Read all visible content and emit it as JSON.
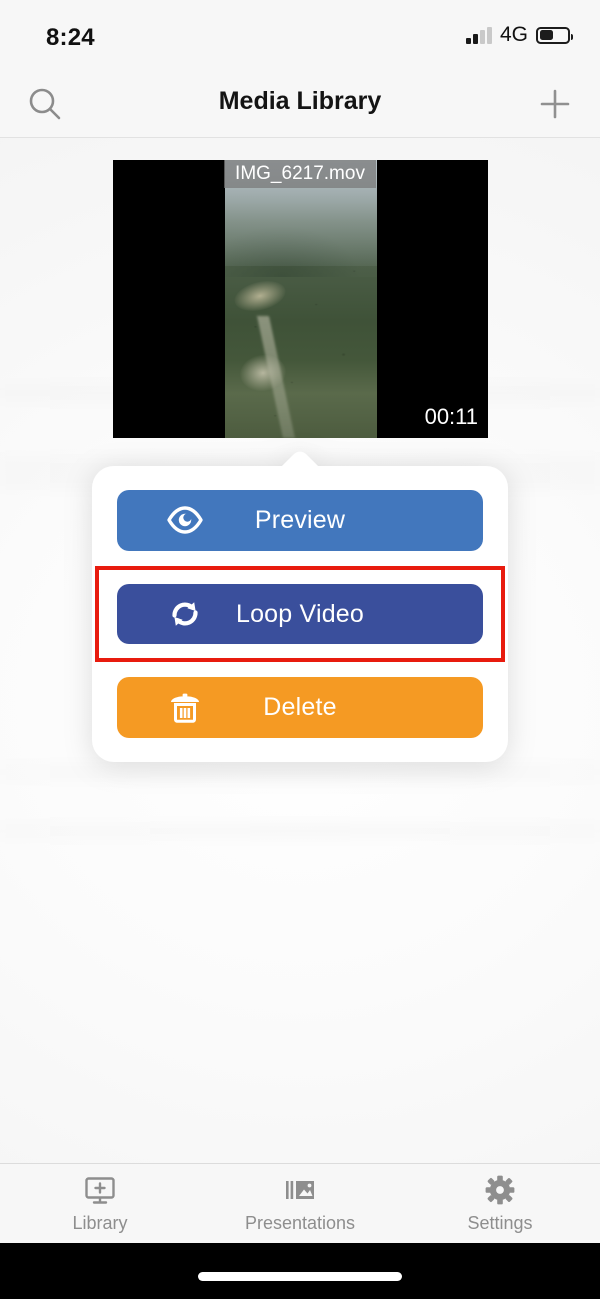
{
  "status_bar": {
    "time": "8:24",
    "network": "4G",
    "signal_bars_filled": 2,
    "signal_bars_total": 4,
    "battery_percent": 40
  },
  "nav_bar": {
    "title": "Media Library",
    "search_icon": "search-icon",
    "add_icon": "plus-icon"
  },
  "media_item": {
    "filename": "IMG_6217.mov",
    "duration": "00:11",
    "thumbnail_description": "aerial view of forested mountain valley",
    "letterbox_color": "#000000"
  },
  "popover": {
    "actions": [
      {
        "label": "Preview",
        "icon": "eye-icon",
        "color": "#4277bd",
        "highlighted": false
      },
      {
        "label": "Loop Video",
        "icon": "loop-icon",
        "color": "#3a4f9c",
        "highlighted": true
      },
      {
        "label": "Delete",
        "icon": "trash-icon",
        "color": "#f59a23",
        "highlighted": false
      }
    ],
    "highlight_color": "#e81b0e"
  },
  "tab_bar": {
    "tabs": [
      {
        "label": "Library",
        "icon": "monitor-plus-icon",
        "active": false
      },
      {
        "label": "Presentations",
        "icon": "slides-image-icon",
        "active": false
      },
      {
        "label": "Settings",
        "icon": "gear-icon",
        "active": false
      }
    ],
    "inactive_color": "#8e8e8e"
  },
  "home_indicator": {
    "visible": true
  }
}
